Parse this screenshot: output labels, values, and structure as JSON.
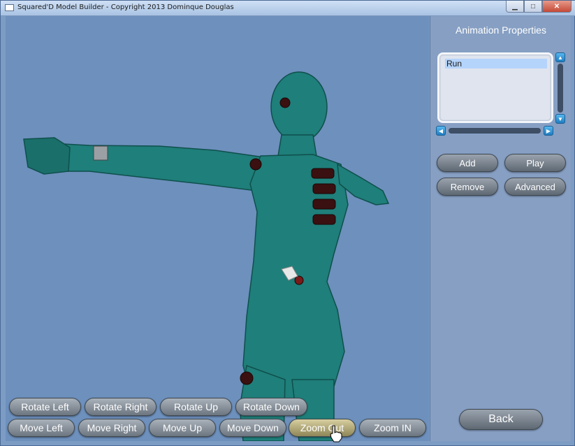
{
  "window": {
    "title": "Squared'D Model Builder - Copyright 2013 Dominque Douglas",
    "minimize_glyph": "▁",
    "maximize_glyph": "□",
    "close_glyph": "✕"
  },
  "panel": {
    "title": "Animation Properties",
    "animations": [
      "Run"
    ],
    "buttons": {
      "add": "Add",
      "play": "Play",
      "remove": "Remove",
      "advanced": "Advanced",
      "back": "Back"
    },
    "scroll_up": "▲",
    "scroll_down": "▼",
    "scroll_left": "◀",
    "scroll_right": "▶"
  },
  "viewport_controls": {
    "row1": [
      "Rotate Left",
      "Rotate Right",
      "Rotate Up",
      "Rotate Down"
    ],
    "row2": [
      "Move Left",
      "Move Right",
      "Move Up",
      "Move Down",
      "Zoom Out",
      "Zoom IN"
    ]
  },
  "colors": {
    "viewport_bg": "#6d90bd",
    "model_teal": "#1f7f7a",
    "panel_bg": "#869fc3"
  }
}
